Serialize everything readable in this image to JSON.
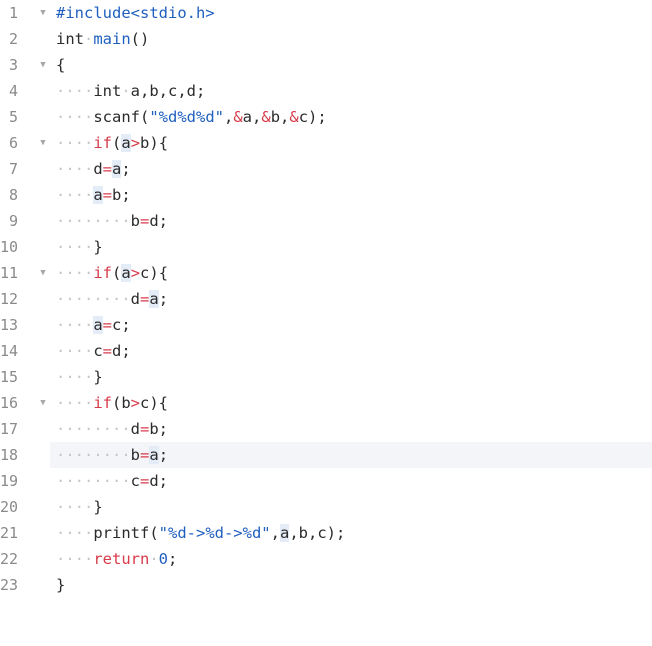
{
  "editor": {
    "active_line": 18,
    "lines": [
      {
        "n": "1",
        "fold": true,
        "segs": [
          {
            "t": "#include<stdio.h>",
            "c": "pp"
          }
        ]
      },
      {
        "n": "2",
        "segs": [
          {
            "t": "int",
            "c": ""
          },
          {
            "t": "·",
            "c": "ws"
          },
          {
            "t": "main",
            "c": "fn"
          },
          {
            "t": "()",
            "c": ""
          }
        ]
      },
      {
        "n": "3",
        "fold": true,
        "segs": [
          {
            "t": "{",
            "c": ""
          }
        ]
      },
      {
        "n": "4",
        "segs": [
          {
            "t": "····",
            "c": "ws"
          },
          {
            "t": "int",
            "c": ""
          },
          {
            "t": "·",
            "c": "ws"
          },
          {
            "t": "a,b,c,d;",
            "c": ""
          }
        ]
      },
      {
        "n": "5",
        "segs": [
          {
            "t": "····",
            "c": "ws"
          },
          {
            "t": "scanf(",
            "c": ""
          },
          {
            "t": "\"%d%d%d\"",
            "c": "str"
          },
          {
            "t": ",",
            "c": ""
          },
          {
            "t": "&",
            "c": "kw"
          },
          {
            "t": "a,",
            "c": ""
          },
          {
            "t": "&",
            "c": "kw"
          },
          {
            "t": "b,",
            "c": ""
          },
          {
            "t": "&",
            "c": "kw"
          },
          {
            "t": "c);",
            "c": ""
          }
        ]
      },
      {
        "n": "6",
        "fold": true,
        "segs": [
          {
            "t": "····",
            "c": "ws"
          },
          {
            "t": "if",
            "c": "kw"
          },
          {
            "t": "(",
            "c": ""
          },
          {
            "t": "a",
            "c": "mark"
          },
          {
            "t": ">",
            "c": "kw"
          },
          {
            "t": "b){",
            "c": ""
          }
        ]
      },
      {
        "n": "7",
        "segs": [
          {
            "t": "····",
            "c": "ws"
          },
          {
            "t": "d",
            "c": ""
          },
          {
            "t": "=",
            "c": "kw"
          },
          {
            "t": "a",
            "c": "mark"
          },
          {
            "t": ";",
            "c": ""
          }
        ]
      },
      {
        "n": "8",
        "segs": [
          {
            "t": "····",
            "c": "ws"
          },
          {
            "t": "a",
            "c": "mark"
          },
          {
            "t": "=",
            "c": "kw"
          },
          {
            "t": "b;",
            "c": ""
          }
        ]
      },
      {
        "n": "9",
        "segs": [
          {
            "t": "········",
            "c": "ws"
          },
          {
            "t": "b",
            "c": ""
          },
          {
            "t": "=",
            "c": "kw"
          },
          {
            "t": "d;",
            "c": ""
          }
        ]
      },
      {
        "n": "10",
        "segs": [
          {
            "t": "····",
            "c": "ws"
          },
          {
            "t": "}",
            "c": ""
          }
        ]
      },
      {
        "n": "11",
        "fold": true,
        "segs": [
          {
            "t": "····",
            "c": "ws"
          },
          {
            "t": "if",
            "c": "kw"
          },
          {
            "t": "(",
            "c": ""
          },
          {
            "t": "a",
            "c": "mark"
          },
          {
            "t": ">",
            "c": "kw"
          },
          {
            "t": "c){",
            "c": ""
          }
        ]
      },
      {
        "n": "12",
        "segs": [
          {
            "t": "········",
            "c": "ws"
          },
          {
            "t": "d",
            "c": ""
          },
          {
            "t": "=",
            "c": "kw"
          },
          {
            "t": "a",
            "c": "mark"
          },
          {
            "t": ";",
            "c": ""
          }
        ]
      },
      {
        "n": "13",
        "segs": [
          {
            "t": "····",
            "c": "ws"
          },
          {
            "t": "a",
            "c": "mark"
          },
          {
            "t": "=",
            "c": "kw"
          },
          {
            "t": "c;",
            "c": ""
          }
        ]
      },
      {
        "n": "14",
        "segs": [
          {
            "t": "····",
            "c": "ws"
          },
          {
            "t": "c",
            "c": ""
          },
          {
            "t": "=",
            "c": "kw"
          },
          {
            "t": "d;",
            "c": ""
          }
        ]
      },
      {
        "n": "15",
        "segs": [
          {
            "t": "····",
            "c": "ws"
          },
          {
            "t": "}",
            "c": ""
          }
        ]
      },
      {
        "n": "16",
        "fold": true,
        "segs": [
          {
            "t": "····",
            "c": "ws"
          },
          {
            "t": "if",
            "c": "kw"
          },
          {
            "t": "(b",
            "c": ""
          },
          {
            "t": ">",
            "c": "kw"
          },
          {
            "t": "c){",
            "c": ""
          }
        ]
      },
      {
        "n": "17",
        "segs": [
          {
            "t": "········",
            "c": "ws"
          },
          {
            "t": "d",
            "c": ""
          },
          {
            "t": "=",
            "c": "kw"
          },
          {
            "t": "b;",
            "c": ""
          }
        ]
      },
      {
        "n": "18",
        "segs": [
          {
            "t": "········",
            "c": "ws"
          },
          {
            "t": "b",
            "c": ""
          },
          {
            "t": "=",
            "c": "kw"
          },
          {
            "t": "a",
            "c": "mark"
          },
          {
            "t": ";",
            "c": ""
          }
        ]
      },
      {
        "n": "19",
        "segs": [
          {
            "t": "········",
            "c": "ws"
          },
          {
            "t": "c",
            "c": ""
          },
          {
            "t": "=",
            "c": "kw"
          },
          {
            "t": "d;",
            "c": ""
          }
        ]
      },
      {
        "n": "20",
        "segs": [
          {
            "t": "····",
            "c": "ws"
          },
          {
            "t": "}",
            "c": ""
          }
        ]
      },
      {
        "n": "21",
        "segs": [
          {
            "t": "····",
            "c": "ws"
          },
          {
            "t": "printf(",
            "c": ""
          },
          {
            "t": "\"%d->%d->%d\"",
            "c": "str"
          },
          {
            "t": ",",
            "c": ""
          },
          {
            "t": "a",
            "c": "mark"
          },
          {
            "t": ",b,c);",
            "c": ""
          }
        ]
      },
      {
        "n": "22",
        "segs": [
          {
            "t": "····",
            "c": "ws"
          },
          {
            "t": "return",
            "c": "kw"
          },
          {
            "t": "·",
            "c": "ws"
          },
          {
            "t": "0",
            "c": "num"
          },
          {
            "t": ";",
            "c": ""
          }
        ]
      },
      {
        "n": "23",
        "segs": [
          {
            "t": "}",
            "c": ""
          }
        ]
      }
    ]
  }
}
